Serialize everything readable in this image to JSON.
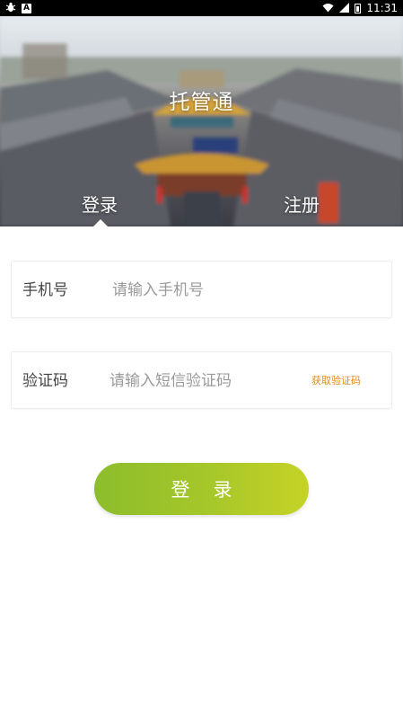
{
  "status_bar": {
    "left_icons": [
      "bug-icon",
      "a-notification-icon"
    ],
    "right_icons": [
      "wifi-icon",
      "signal-icon",
      "battery-icon"
    ],
    "time": "11:31"
  },
  "header": {
    "app_title": "托管通",
    "tabs": [
      {
        "label": "登录",
        "active": true
      },
      {
        "label": "注册",
        "active": false
      }
    ]
  },
  "form": {
    "phone": {
      "label": "手机号",
      "placeholder": "请输入手机号",
      "value": ""
    },
    "code": {
      "label": "验证码",
      "placeholder": "请输入短信验证码",
      "value": "",
      "get_code_label": "获取验证码"
    },
    "submit_label": "登录"
  },
  "colors": {
    "get_code": "#e0891f",
    "button_start": "#8cbd2c",
    "button_end": "#c6d326"
  }
}
